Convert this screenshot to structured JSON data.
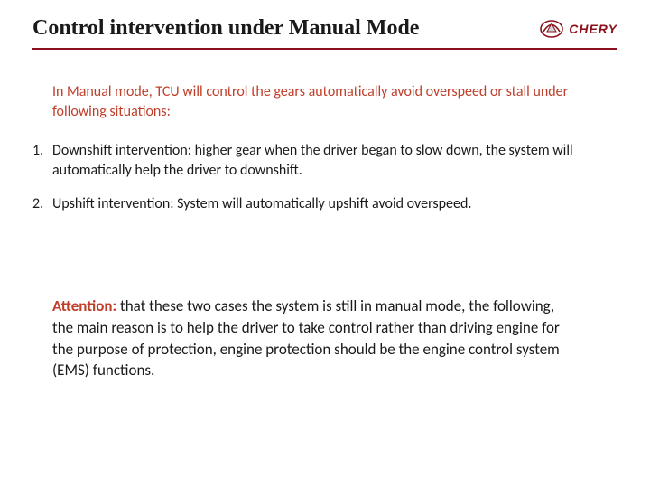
{
  "header": {
    "title": "Control intervention under Manual Mode",
    "logo": {
      "brand": "CHERY"
    }
  },
  "intro": "In Manual mode, TCU will control the gears automatically avoid overspeed or stall under following situations:",
  "list": {
    "items": [
      {
        "num": "1.",
        "text": "Downshift intervention: higher gear when the driver began to slow down, the system will automatically help the driver to downshift."
      },
      {
        "num": "2.",
        "text": "Upshift intervention: System will automatically upshift  avoid overspeed."
      }
    ]
  },
  "attention": {
    "label": "Attention:",
    "text": " that these two cases the system is still in manual mode, the following, the main reason is to help the driver to take control rather than driving engine for the purpose of protection, engine protection should be the engine control system (EMS) functions."
  },
  "colors": {
    "accent": "#8b0f1a",
    "warm_text": "#bf3f2a"
  }
}
